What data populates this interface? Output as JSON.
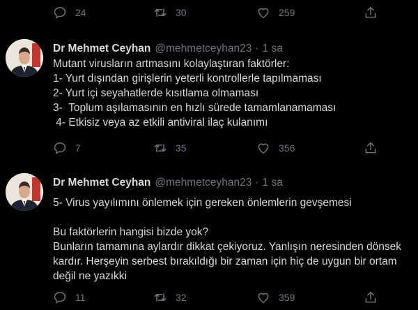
{
  "top_actions": {
    "replies": "24",
    "retweets": "30",
    "likes": "259"
  },
  "tweets": [
    {
      "name": "Dr Mehmet Ceyhan",
      "handle": "@mehmetceyhan23",
      "separator": "·",
      "time": "1 sa",
      "lines": [
        "Mutant virusların artmasını kolaylaştıran faktörler:",
        "1- Yurt dışından girişlerin yeterli kontrollerle tapılmaması",
        "2- Yurt içi seyahatlerde kısıtlama olmaması",
        "3-  Toplum aşılamasının en hızlı sürede tamamlanamaması",
        " 4- Etkisiz veya az etkili antiviral ilaç kulanımı"
      ],
      "actions": {
        "replies": "7",
        "retweets": "35",
        "likes": "356"
      }
    },
    {
      "name": "Dr Mehmet Ceyhan",
      "handle": "@mehmetceyhan23",
      "separator": "·",
      "time": "1 sa",
      "lines": [
        "5- Virus yayılımını önlemek için gereken önlemlerin gevşemesi",
        "",
        "Bu faktörlerin hangisi bizde yok?",
        "Bunların tamamına aylardır dikkat çekiyoruz. Yanlışın neresinden dönsek",
        "kardır. Herşeyin serbest bırakıldığı bir zaman için hiç de uygun bir ortam",
        "değil ne yazıkki"
      ],
      "actions": {
        "replies": "11",
        "retweets": "32",
        "likes": "359"
      }
    }
  ],
  "icons": {
    "reply": "reply-icon",
    "retweet": "retweet-icon",
    "like": "heart-icon",
    "share": "share-icon"
  },
  "colors": {
    "background": "#000000",
    "text": "#d9d9d9",
    "muted": "#6e767d"
  }
}
